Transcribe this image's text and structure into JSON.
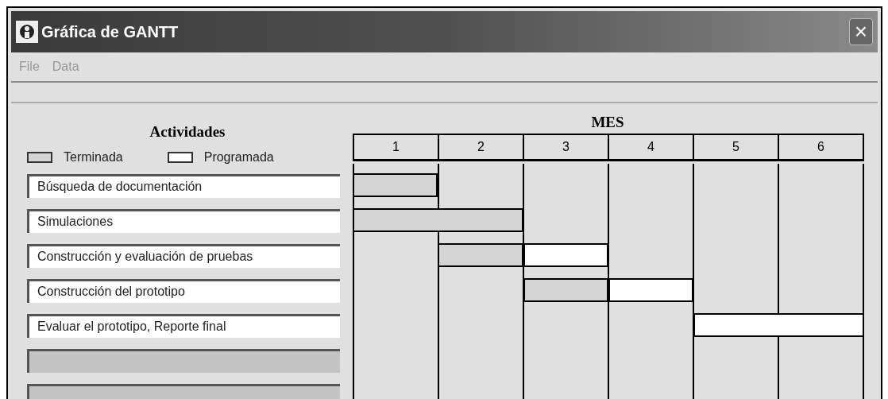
{
  "window": {
    "title": "Gráfica de GANTT",
    "close": "×"
  },
  "menu": [
    {
      "label": "File"
    },
    {
      "label": "Data"
    }
  ],
  "activities_title": "Actividades",
  "legend": [
    {
      "kind": "terminada",
      "label": "Terminada"
    },
    {
      "kind": "programada",
      "label": "Programada"
    }
  ],
  "activities": [
    {
      "name": "Búsqueda de documentación",
      "disabled": false,
      "timeline": [
        {
          "kind": "terminada"
        },
        {
          "kind": "none"
        },
        {
          "kind": "none"
        },
        {
          "kind": "none"
        },
        {
          "kind": "none"
        },
        {
          "kind": "none"
        }
      ]
    },
    {
      "name": "Simulaciones",
      "disabled": false,
      "timeline": [
        {
          "kind": "terminada"
        },
        {
          "kind": "terminada"
        },
        {
          "kind": "none"
        },
        {
          "kind": "none"
        },
        {
          "kind": "none"
        },
        {
          "kind": "none"
        }
      ]
    },
    {
      "name": "Construcción y evaluación de pruebas",
      "disabled": false,
      "timeline": [
        {
          "kind": "none"
        },
        {
          "kind": "terminada"
        },
        {
          "kind": "programada"
        },
        {
          "kind": "none"
        },
        {
          "kind": "none"
        },
        {
          "kind": "none"
        }
      ]
    },
    {
      "name": "Construcción del prototipo",
      "disabled": false,
      "timeline": [
        {
          "kind": "none"
        },
        {
          "kind": "none"
        },
        {
          "kind": "terminada"
        },
        {
          "kind": "programada"
        },
        {
          "kind": "none"
        },
        {
          "kind": "none"
        }
      ]
    },
    {
      "name": "Evaluar el prototipo, Reporte final",
      "disabled": false,
      "timeline": [
        {
          "kind": "none"
        },
        {
          "kind": "none"
        },
        {
          "kind": "none"
        },
        {
          "kind": "none"
        },
        {
          "kind": "programada"
        },
        {
          "kind": "programada"
        }
      ]
    },
    {
      "disabled": true
    },
    {
      "disabled": true
    }
  ],
  "months_title": "MES",
  "months": [
    "1",
    "2",
    "3",
    "4",
    "5",
    "6"
  ]
}
